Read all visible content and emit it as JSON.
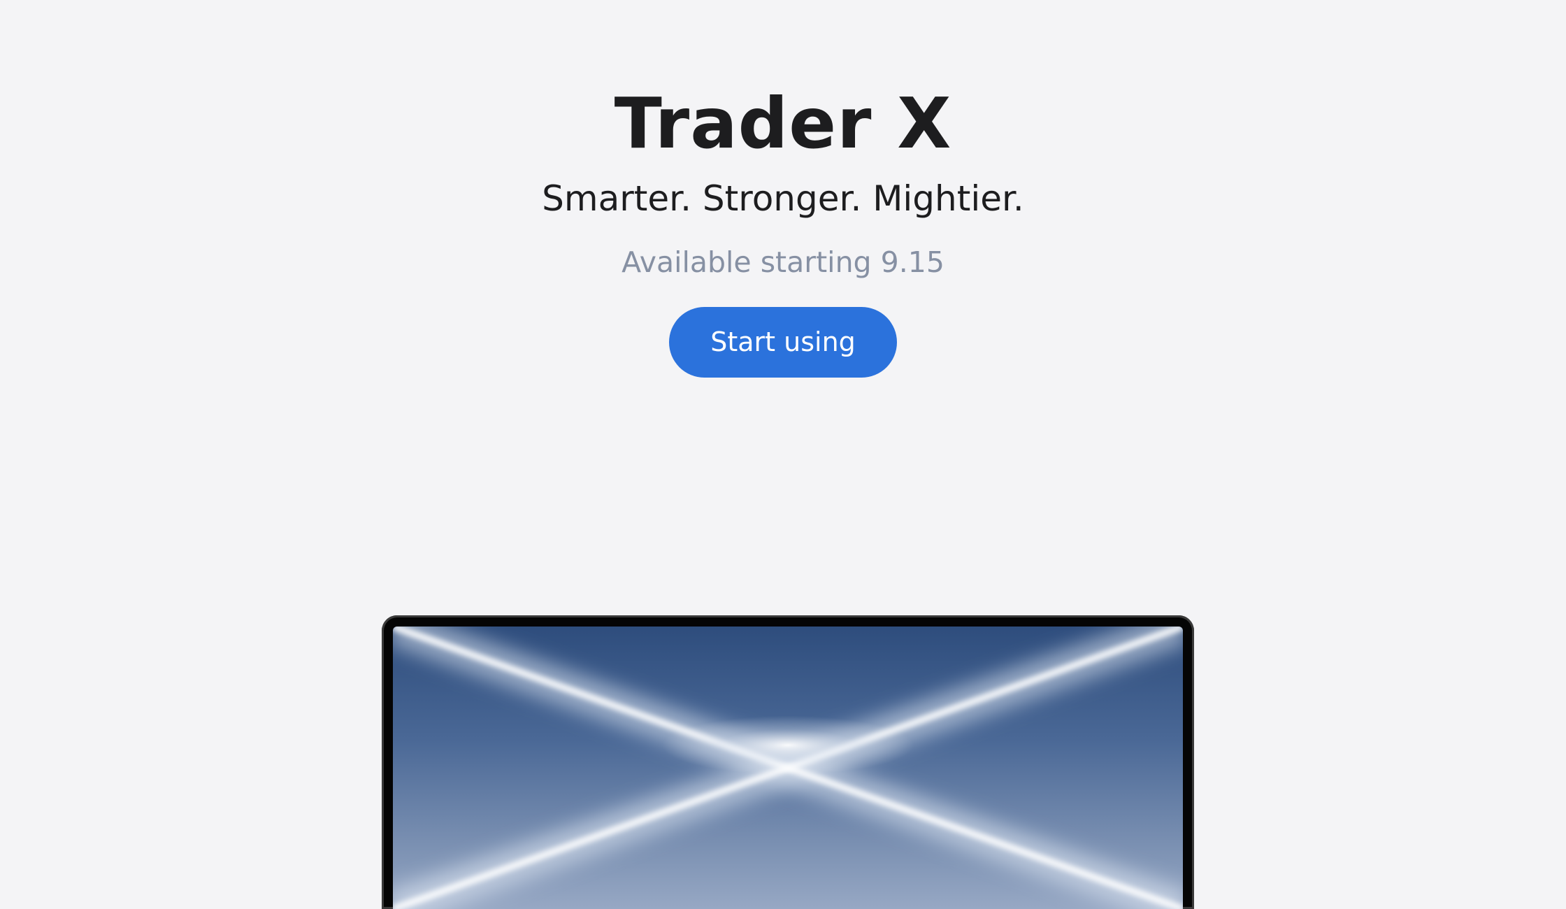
{
  "hero": {
    "title": "Trader X",
    "tagline": "Smarter. Stronger. Mightier.",
    "availability": "Available starting 9.15",
    "cta_label": "Start using"
  },
  "colors": {
    "background": "#f4f4f6",
    "title_text": "#1d1d1f",
    "availability_text": "#8690a3",
    "cta_background": "#2b72dc",
    "cta_text": "#ffffff",
    "laptop_bezel": "#050505",
    "screen_top": "#2e4d7d",
    "screen_bottom": "#97a8c4"
  },
  "device": {
    "type": "laptop-screen",
    "wallpaper": "blue-light-streak-wallpaper"
  }
}
